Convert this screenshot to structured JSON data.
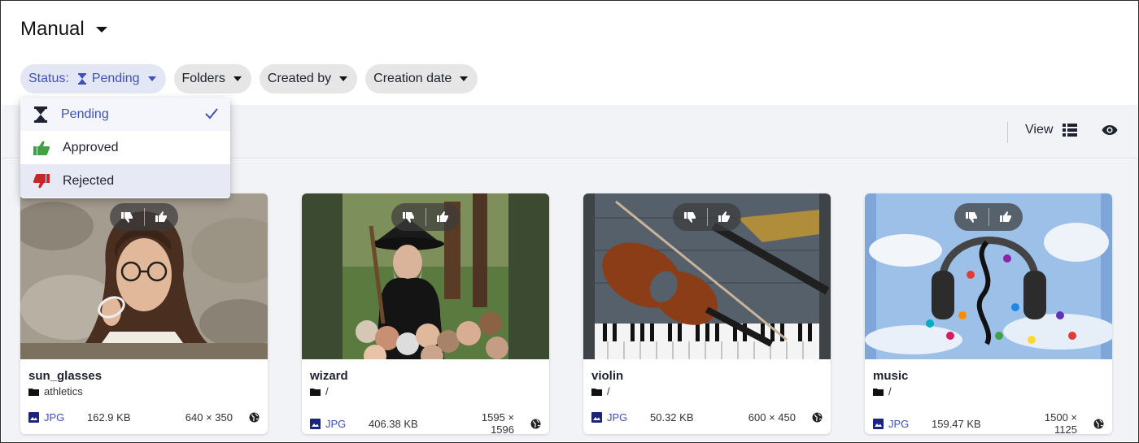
{
  "header": {
    "title": "Manual"
  },
  "filters": {
    "status": {
      "prefix": "Status:",
      "value": "Pending"
    },
    "folders": "Folders",
    "created_by": "Created by",
    "creation_date": "Creation date"
  },
  "status_menu": {
    "items": [
      {
        "label": "Pending",
        "icon": "hourglass-icon",
        "selected": true
      },
      {
        "label": "Approved",
        "icon": "thumbs-up-icon",
        "selected": false
      },
      {
        "label": "Rejected",
        "icon": "thumbs-down-icon",
        "selected": false
      }
    ]
  },
  "toolbar": {
    "view_label": "View"
  },
  "colors": {
    "accent": "#3f51b5",
    "approved": "#43a047",
    "rejected": "#c62828",
    "band": "#f2f3f7"
  },
  "assets": [
    {
      "name": "sun_glasses",
      "folder": "athletics",
      "format": "JPG",
      "size": "162.9 KB",
      "dimensions": "640 × 350"
    },
    {
      "name": "wizard",
      "folder": "/",
      "format": "JPG",
      "size": "406.38 KB",
      "dimensions": "1595 × 1596"
    },
    {
      "name": "violin",
      "folder": "/",
      "format": "JPG",
      "size": "50.32 KB",
      "dimensions": "600 × 450"
    },
    {
      "name": "music",
      "folder": "/",
      "format": "JPG",
      "size": "159.47 KB",
      "dimensions": "1500 × 1125"
    }
  ]
}
